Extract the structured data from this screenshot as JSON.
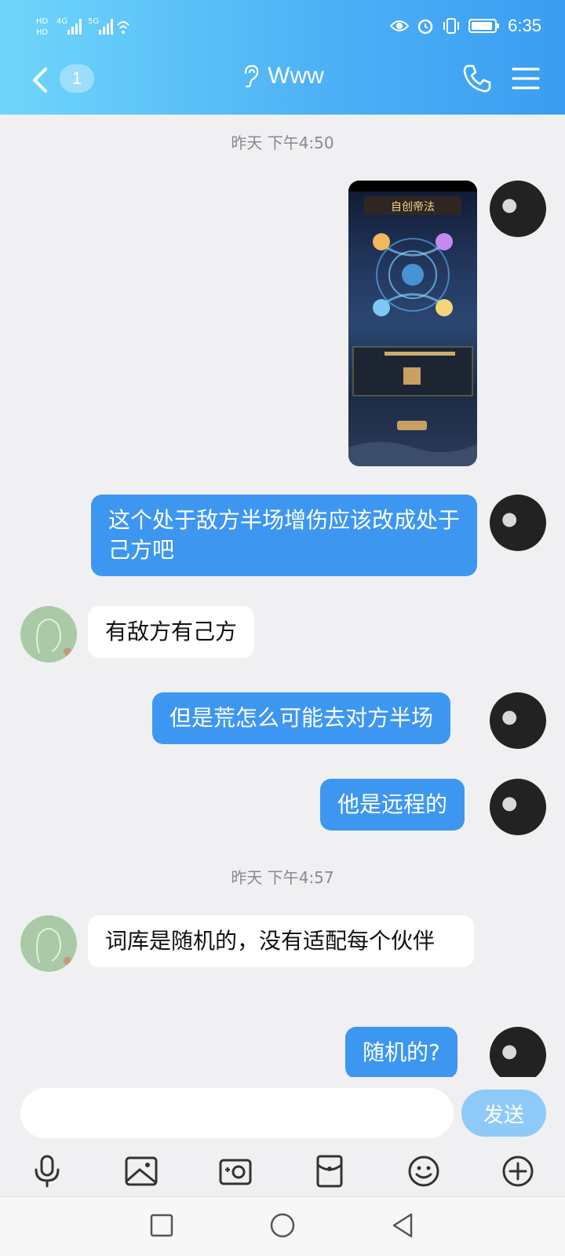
{
  "status_bar": {
    "left_labels": [
      "HD",
      "4G",
      "5G"
    ],
    "time": "6:35"
  },
  "header": {
    "back_badge": "1",
    "title": "Www"
  },
  "messages": {
    "ts1": "昨天 下午4:50",
    "m1": "这个处于敌方半场增伤应该改成处于己方吧",
    "m2": "有敌方有己方",
    "m3": "但是荒怎么可能去对方半场",
    "m4": "他是远程的",
    "ts2": "昨天 下午4:57",
    "m5": "词库是随机的，没有适配每个伙伴",
    "m6": "随机的?"
  },
  "image_message": {
    "title": "自创帝法"
  },
  "input": {
    "placeholder": "",
    "send_label": "发送"
  },
  "toolbar_icons": [
    "microphone-icon",
    "picture-icon",
    "camera-icon",
    "red-packet-icon",
    "emoji-icon",
    "plus-icon"
  ],
  "colors": {
    "header_gradient_start": "#6fd6fb",
    "header_gradient_end": "#3a9df2",
    "my_bubble": "#3d97f1",
    "other_bubble": "#ffffff",
    "background": "#f0f0f2",
    "send_button": "#8fc9f7"
  }
}
